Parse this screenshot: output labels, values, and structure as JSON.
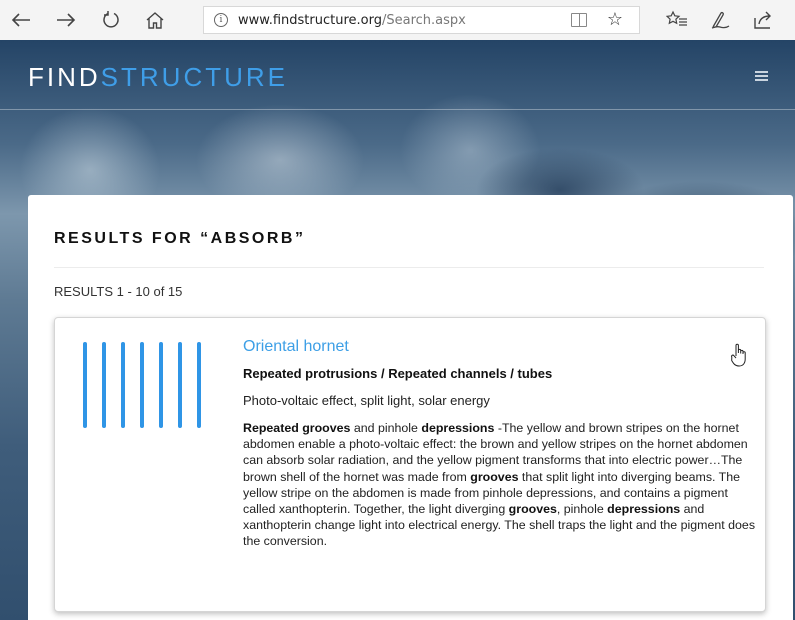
{
  "browser": {
    "url_domain": "www.findstructure.org",
    "url_path": "/Search.aspx"
  },
  "header": {
    "brand_part1": "FIND",
    "brand_part2": "STRUCTURE"
  },
  "results": {
    "title": "RESULTS FOR “ABSORB”",
    "count_text": "RESULTS 1 - 10 of 15"
  },
  "result": {
    "name": "Oriental hornet",
    "features": "Repeated protrusions / Repeated channels / tubes",
    "functions": "Photo-voltaic effect, split light, solar energy",
    "desc": [
      {
        "text": "Repeated grooves",
        "bold": true
      },
      {
        "text": " and pinhole ",
        "bold": false
      },
      {
        "text": "depressions",
        "bold": true
      },
      {
        "text": " -The yellow and brown stripes on the hornet abdomen enable a photo-voltaic effect: the brown and yellow stripes on the hornet abdomen can absorb solar radiation, and the yellow pigment transforms that into electric power…The brown shell of the hornet was made from ",
        "bold": false
      },
      {
        "text": "grooves",
        "bold": true
      },
      {
        "text": " that split light into diverging beams. The yellow stripe on the abdomen is made from pinhole depressions, and contains a pigment called xanthopterin. Together, the light diverging ",
        "bold": false
      },
      {
        "text": "grooves",
        "bold": true
      },
      {
        "text": ", pinhole ",
        "bold": false
      },
      {
        "text": "depressions",
        "bold": true
      },
      {
        "text": " and xanthopterin change light into electrical energy. The shell traps the light and the pigment does the conversion.",
        "bold": false
      }
    ],
    "stripe_color": "#2f95e6"
  },
  "colors": {
    "brand_accent": "#3f9ee8",
    "link": "#3d9fe6"
  },
  "icons": [
    "back-icon",
    "forward-icon",
    "refresh-icon",
    "home-icon",
    "info-icon",
    "reading-view-icon",
    "favorite-star-icon",
    "favorites-list-icon",
    "pen-icon",
    "share-icon",
    "menu-icon",
    "hand-cursor-icon"
  ]
}
